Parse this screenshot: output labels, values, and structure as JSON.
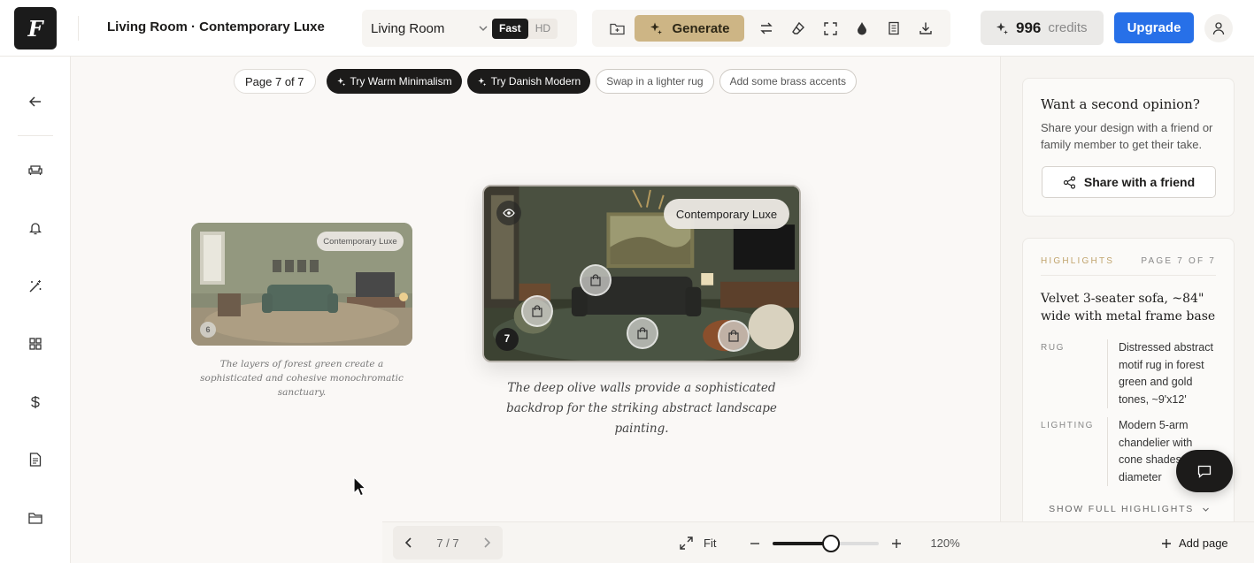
{
  "app": {
    "logo_letter": "F"
  },
  "header": {
    "project_title": "Living Room · Contemporary Luxe",
    "room_select": "Living Room",
    "quality_options": [
      "Fast",
      "HD"
    ],
    "quality_selected": "Fast",
    "generate_label": "Generate",
    "credits_value": "996",
    "credits_label": "credits",
    "upgrade_label": "Upgrade",
    "icons": [
      "folder-icon",
      "sparkle-icon",
      "swap-icon",
      "eraser-icon",
      "expand-icon",
      "drop-icon",
      "layers-icon",
      "download-icon",
      "user-icon"
    ]
  },
  "sidebar": {
    "icons": [
      "back-arrow-icon",
      "sofa-icon",
      "bell-icon",
      "magic-wand-icon",
      "grid-icon",
      "dollar-icon",
      "document-icon",
      "folder-icon"
    ]
  },
  "chips": {
    "page_label": "Page 7 of 7",
    "suggestions": [
      {
        "label": "Try Warm Minimalism",
        "style": "dark",
        "icon": "sparkle-icon"
      },
      {
        "label": "Try Danish Modern",
        "style": "dark",
        "icon": "sparkle-icon"
      },
      {
        "label": "Swap in a lighter rug",
        "style": "light"
      },
      {
        "label": "Add some brass accents",
        "style": "light"
      }
    ]
  },
  "canvas": {
    "prev_card": {
      "tag": "Contemporary Luxe",
      "page_number": "6",
      "caption": "The layers of forest green create a sophisticated and cohesive monochromatic sanctuary."
    },
    "current_card": {
      "tag": "Contemporary Luxe",
      "page_number": "7",
      "caption": "The deep olive walls provide a sophisticated backdrop for the striking abstract landscape painting."
    }
  },
  "right_panel": {
    "opinion": {
      "title": "Want a second opinion?",
      "body": "Share your design with a friend or family member to get their take.",
      "share_label": "Share with a friend"
    },
    "highlights": {
      "label": "HIGHLIGHTS",
      "page_label": "PAGE 7 OF 7",
      "title": "Velvet 3-seater sofa, ~84\" wide with metal frame base",
      "items": [
        {
          "key": "RUG",
          "value": "Distressed abstract motif rug in forest green and gold tones, ~9'x12'"
        },
        {
          "key": "LIGHTING",
          "value": "Modern 5-arm chandelier with cone shades, ~ diameter"
        }
      ],
      "show_full_label": "SHOW FULL HIGHLIGHTS"
    }
  },
  "bottom": {
    "page_indicator": "7 / 7",
    "fit_label": "Fit",
    "zoom_level": "120%",
    "zoom_fraction": 0.55,
    "add_page_label": "Add page"
  }
}
